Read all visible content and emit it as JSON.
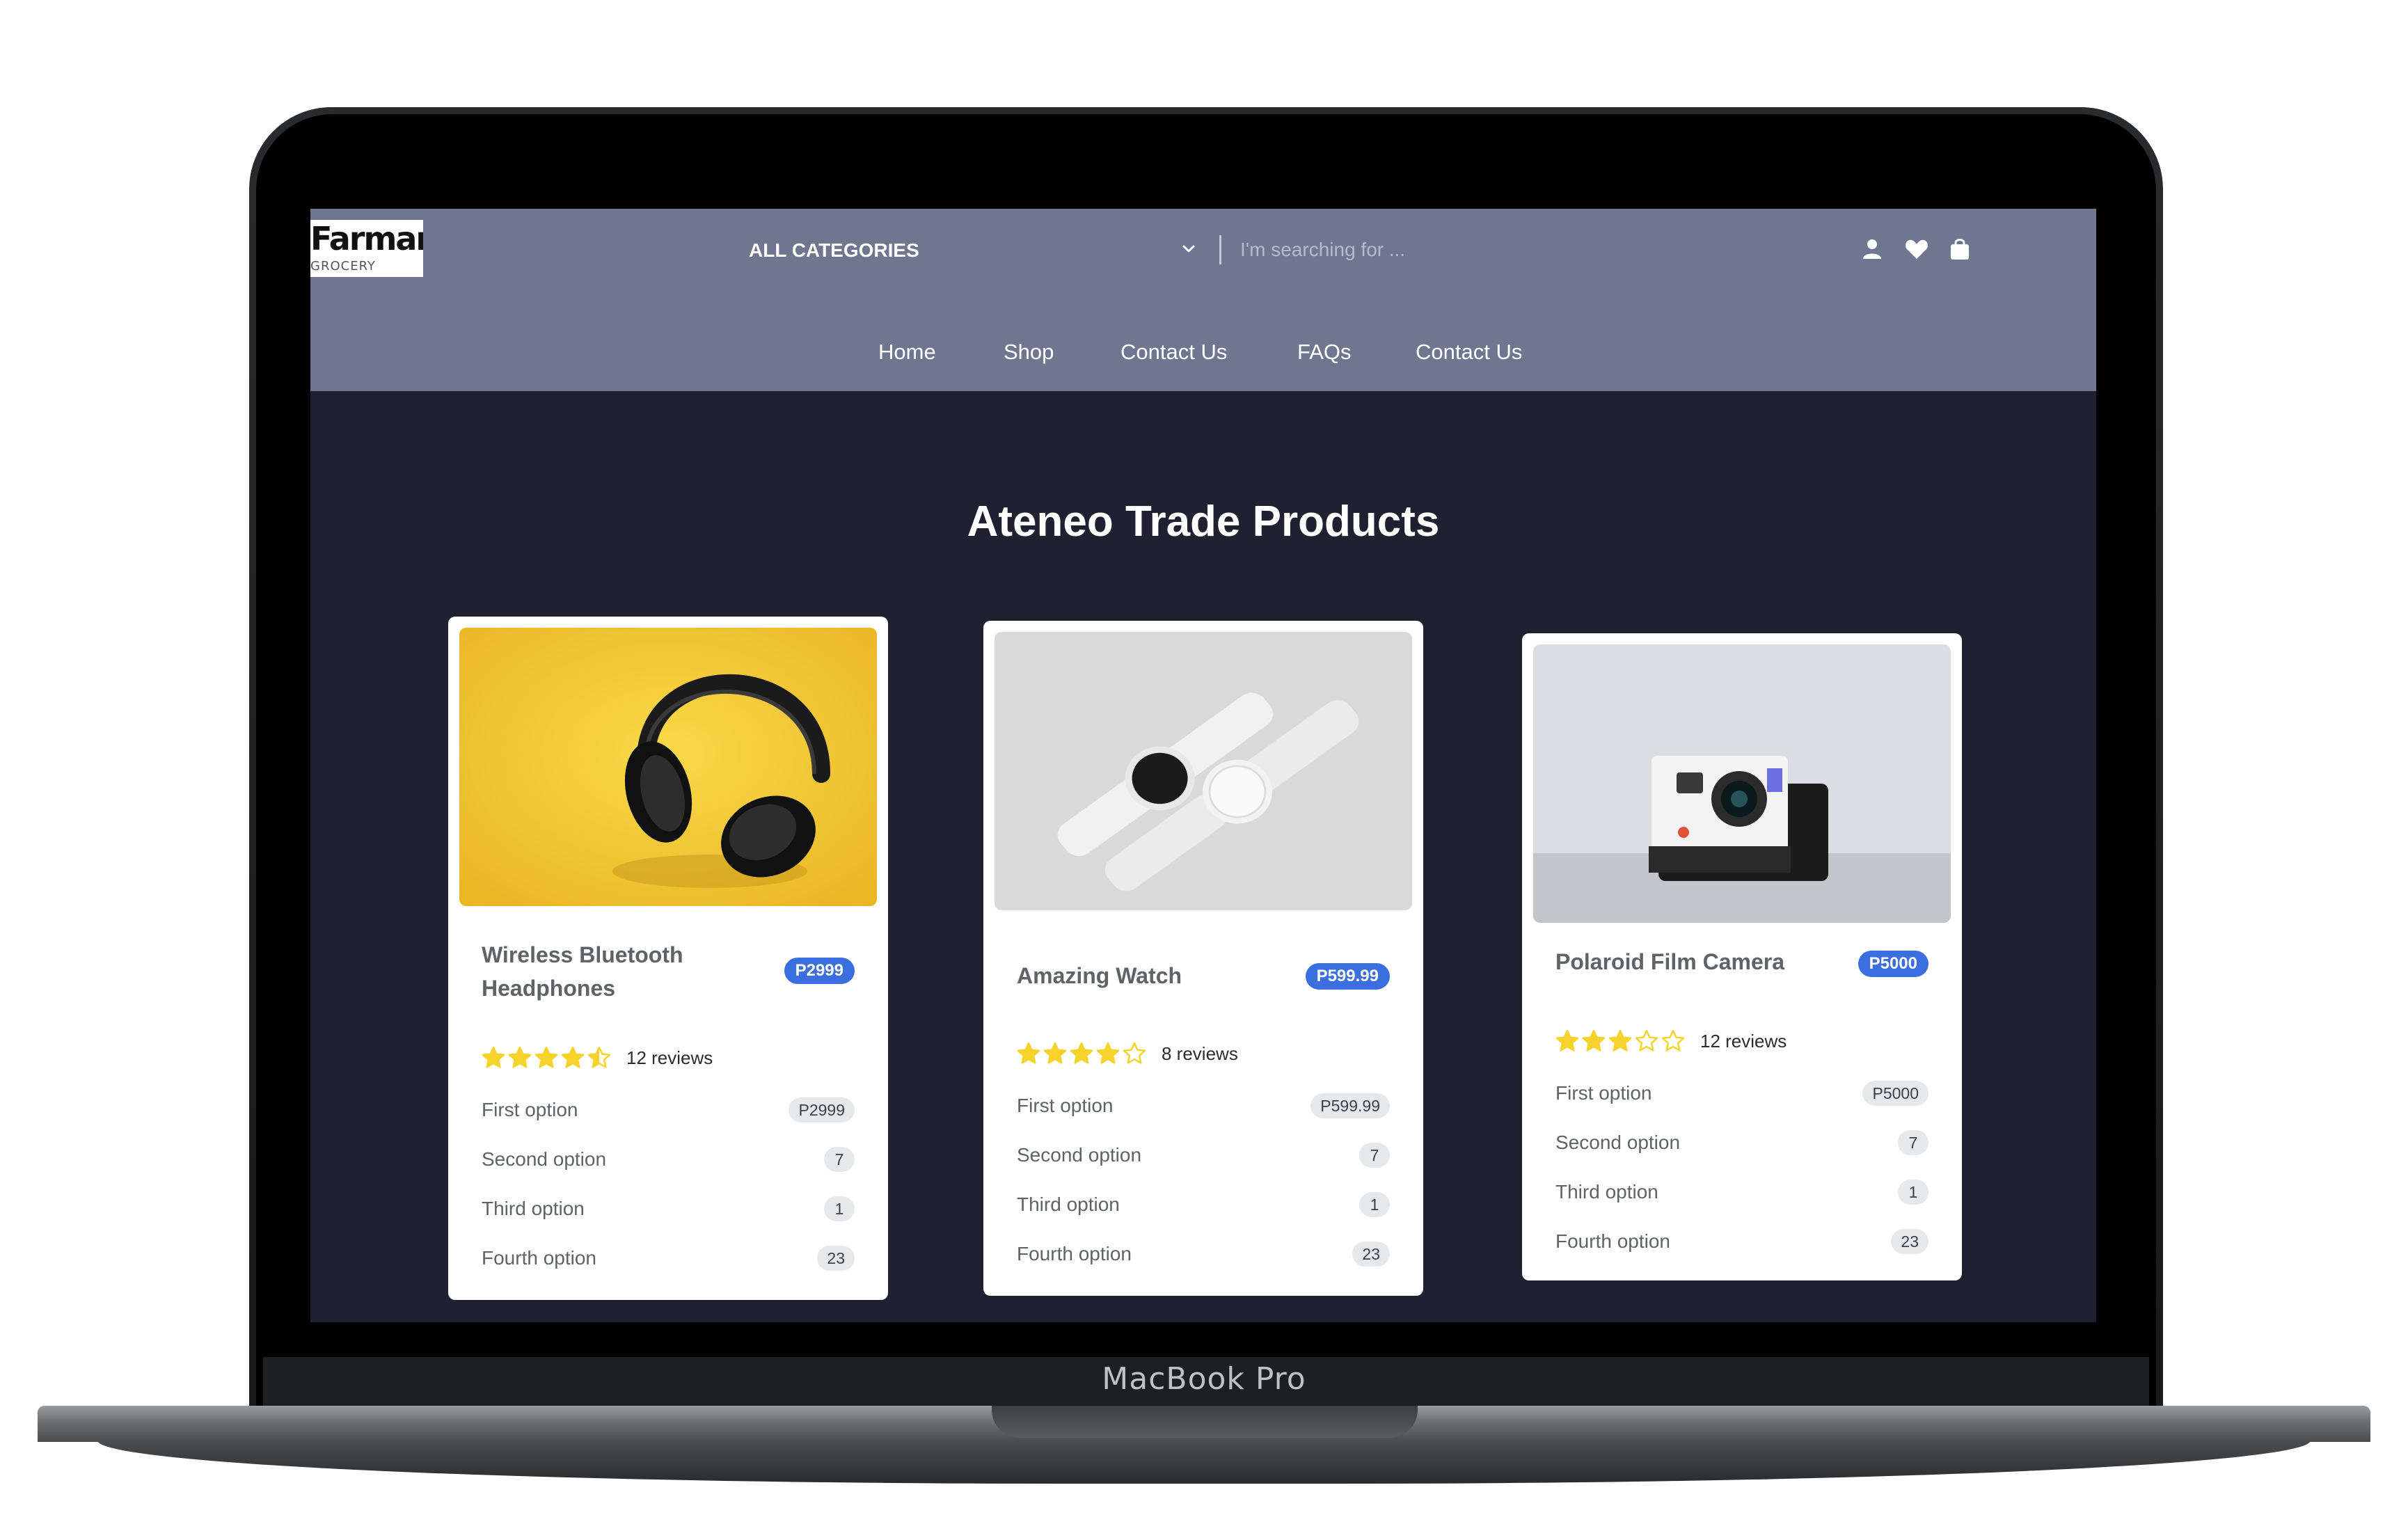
{
  "device": {
    "label": "MacBook Pro"
  },
  "header": {
    "logo": {
      "name": "Farmart",
      "tagline": "GROCERY"
    },
    "category_label": "ALL CATEGORIES",
    "search_placeholder": "I'm searching for ...",
    "icons": [
      "user-icon",
      "heart-icon",
      "bag-icon"
    ],
    "nav": [
      "Home",
      "Shop",
      "Contact Us",
      "FAQs",
      "Contact Us"
    ]
  },
  "main": {
    "title": "Ateneo Trade Products",
    "cards": [
      {
        "title": "Wireless Bluetooth Headphones",
        "price": "P2999",
        "rating": 4.5,
        "reviews": "12 reviews",
        "image": "headphones",
        "image_bg": "#f3c531",
        "options": [
          {
            "label": "First option",
            "value": "P2999"
          },
          {
            "label": "Second option",
            "value": "7"
          },
          {
            "label": "Third option",
            "value": "1"
          },
          {
            "label": "Fourth option",
            "value": "23"
          }
        ]
      },
      {
        "title": "Amazing Watch",
        "price": "P599.99",
        "rating": 4,
        "reviews": "8 reviews",
        "image": "smart-watch",
        "image_bg": "#d9d9d9",
        "options": [
          {
            "label": "First option",
            "value": "P599.99"
          },
          {
            "label": "Second option",
            "value": "7"
          },
          {
            "label": "Third option",
            "value": "1"
          },
          {
            "label": "Fourth option",
            "value": "23"
          }
        ]
      },
      {
        "title": "Polaroid Film Camera",
        "price": "P5000",
        "rating": 3,
        "reviews": "12 reviews",
        "image": "polaroid-camera",
        "image_bg": "#dcdde2",
        "options": [
          {
            "label": "First option",
            "value": "P5000"
          },
          {
            "label": "Second option",
            "value": "7"
          },
          {
            "label": "Third option",
            "value": "1"
          },
          {
            "label": "Fourth option",
            "value": "23"
          }
        ]
      }
    ]
  },
  "colors": {
    "header_bg": "#6f768f",
    "page_bg": "#1f2131",
    "accent": "#3b6fe0",
    "star": "#f5d32c"
  }
}
